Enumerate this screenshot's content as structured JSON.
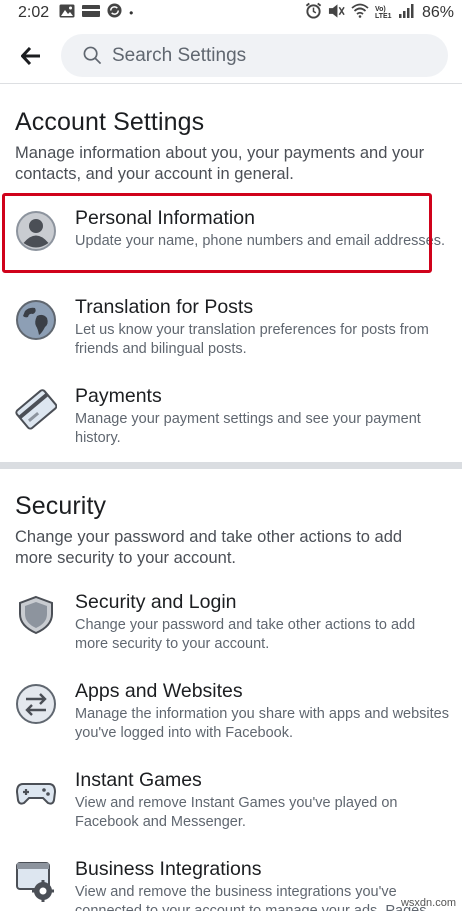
{
  "status_bar": {
    "time": "2:02",
    "dot": "•",
    "network_label": "Vo) LTE1",
    "battery": "86%"
  },
  "header": {
    "search_placeholder": "Search Settings"
  },
  "account_settings": {
    "title": "Account Settings",
    "description": "Manage information about you, your payments and your contacts, and your account in general.",
    "items": [
      {
        "icon": "person-icon",
        "title": "Personal Information",
        "description": "Update your name, phone numbers and email addresses.",
        "highlighted": true
      },
      {
        "icon": "globe-icon",
        "title": "Translation for Posts",
        "description": "Let us know your translation preferences for posts from friends and bilingual posts."
      },
      {
        "icon": "credit-card-icon",
        "title": "Payments",
        "description": "Manage your payment settings and see your payment history."
      }
    ]
  },
  "security": {
    "title": "Security",
    "description": "Change your password and take other actions to add more security to your account.",
    "items": [
      {
        "icon": "shield-icon",
        "title": "Security and Login",
        "description": "Change your password and take other actions to add more security to your account."
      },
      {
        "icon": "swap-arrows-icon",
        "title": "Apps and Websites",
        "description": "Manage the information you share with apps and websites you've logged into with Facebook."
      },
      {
        "icon": "gamepad-icon",
        "title": "Instant Games",
        "description": "View and remove Instant Games you've played on Facebook and Messenger."
      },
      {
        "icon": "business-gear-icon",
        "title": "Business Integrations",
        "description": "View and remove the business integrations you've connected to your account to manage your ads, Pages"
      }
    ]
  },
  "watermark": "wsxdn.com",
  "colors": {
    "highlight_border": "#d0021b",
    "search_bg": "#f0f2f5",
    "divider": "#dadde1",
    "icon_fill": "#8b96a6"
  }
}
